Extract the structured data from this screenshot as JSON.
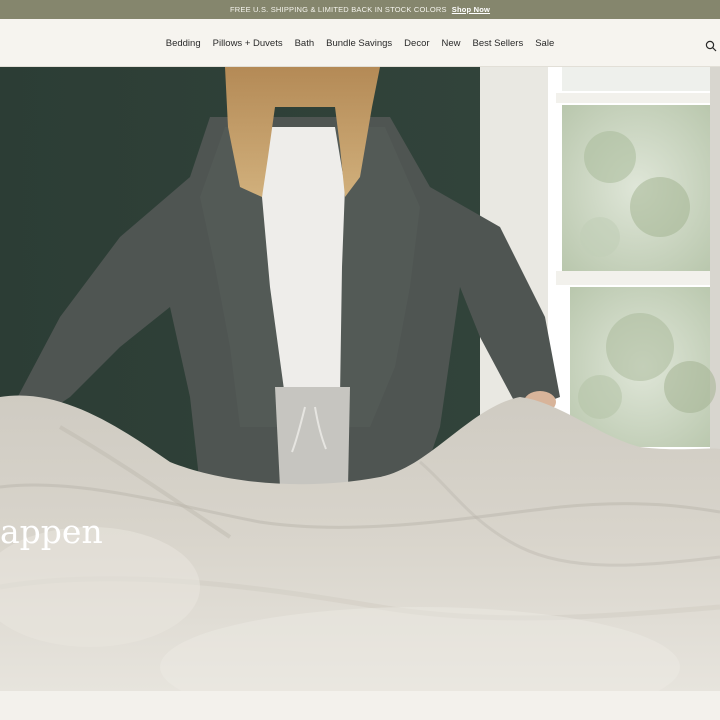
{
  "announcement": {
    "text": "FREE U.S. SHIPPING & LIMITED BACK IN STOCK COLORS",
    "link": "Shop Now"
  },
  "nav": {
    "items": [
      {
        "label": "Bedding"
      },
      {
        "label": "Pillows + Duvets"
      },
      {
        "label": "Bath"
      },
      {
        "label": "Bundle Savings"
      },
      {
        "label": "Decor"
      },
      {
        "label": "New"
      },
      {
        "label": "Best Sellers"
      },
      {
        "label": "Sale"
      }
    ],
    "search_icon": "search-icon"
  },
  "hero": {
    "heading_fragment": "appen"
  },
  "colors": {
    "announcement_bg": "#85866d",
    "nav_bg": "#f6f4ef",
    "wall": "#2f4038",
    "page_bg": "#f3f1ec"
  }
}
